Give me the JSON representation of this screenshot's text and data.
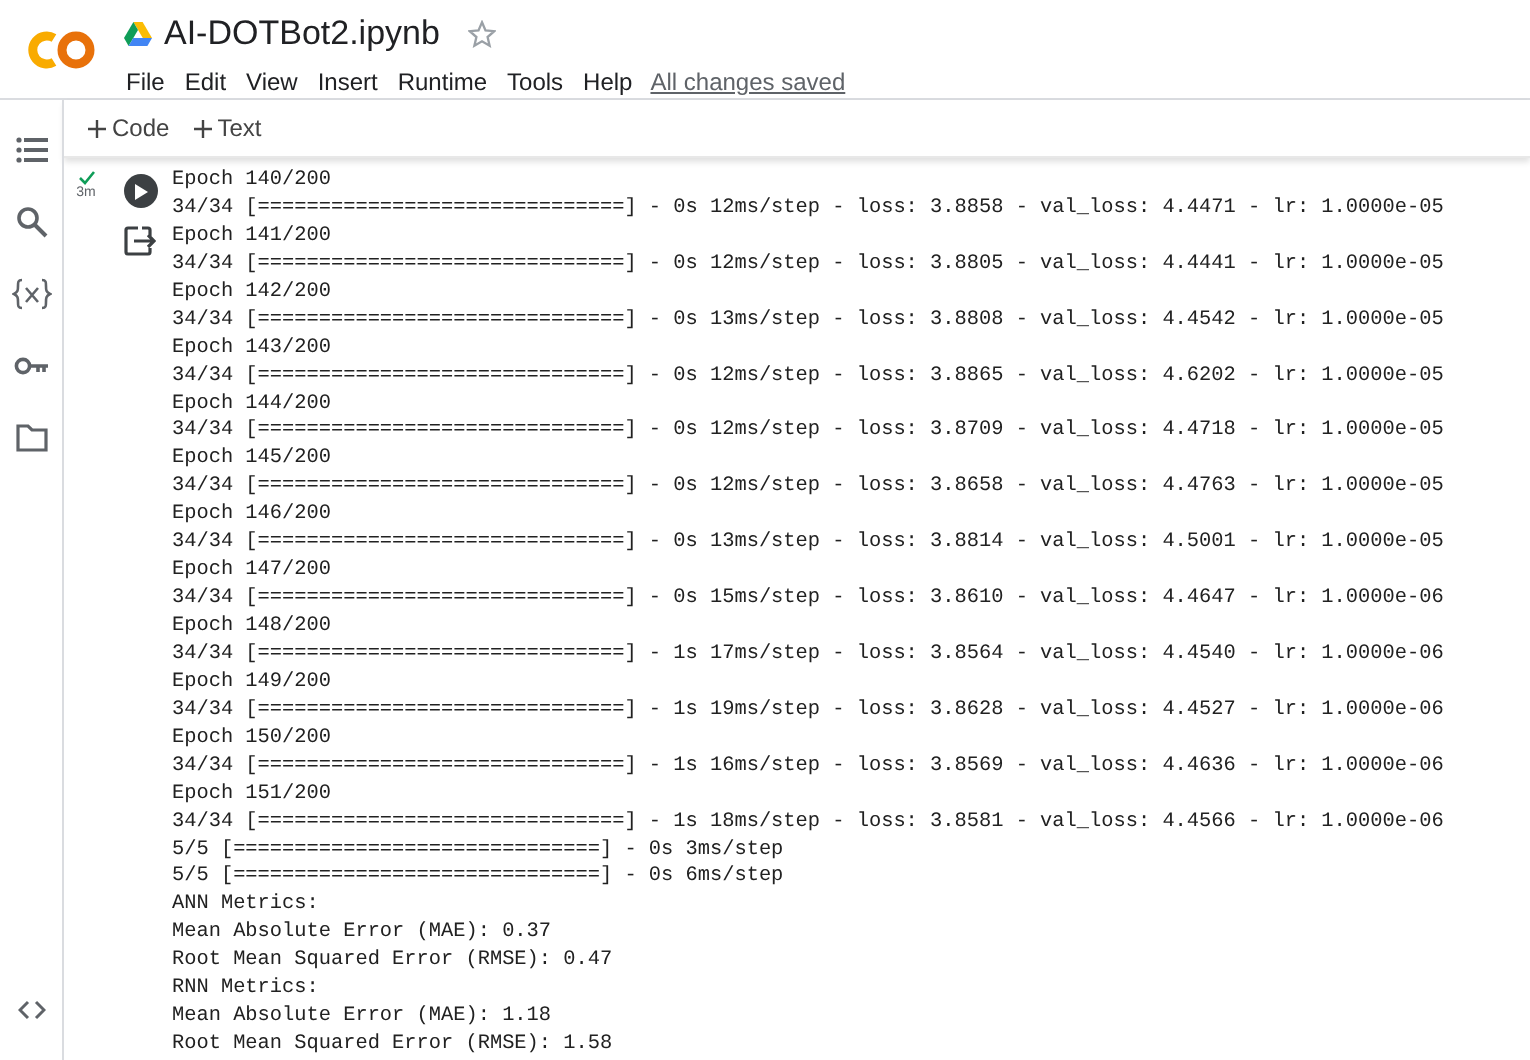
{
  "notebook": {
    "title": "AI-DOTBot2.ipynb",
    "starred": false
  },
  "menu": [
    "File",
    "Edit",
    "View",
    "Insert",
    "Runtime",
    "Tools",
    "Help"
  ],
  "save_status": "All changes saved",
  "toolbar": [
    "Code",
    "Text"
  ],
  "cell": {
    "completed": true,
    "elapsed": "3m",
    "output": [
      "Epoch 140/200",
      "34/34 [==============================] - 0s 12ms/step - loss: 3.8858 - val_loss: 4.4471 - lr: 1.0000e-05",
      "Epoch 141/200",
      "34/34 [==============================] - 0s 12ms/step - loss: 3.8805 - val_loss: 4.4441 - lr: 1.0000e-05",
      "Epoch 142/200",
      "34/34 [==============================] - 0s 13ms/step - loss: 3.8808 - val_loss: 4.4542 - lr: 1.0000e-05",
      "Epoch 143/200",
      "34/34 [==============================] - 0s 12ms/step - loss: 3.8865 - val_loss: 4.6202 - lr: 1.0000e-05",
      "Epoch 144/200",
      "34/34 [==============================] - 0s 12ms/step - loss: 3.8709 - val_loss: 4.4718 - lr: 1.0000e-05",
      "Epoch 145/200",
      "34/34 [==============================] - 0s 12ms/step - loss: 3.8658 - val_loss: 4.4763 - lr: 1.0000e-05",
      "Epoch 146/200",
      "34/34 [==============================] - 0s 13ms/step - loss: 3.8814 - val_loss: 4.5001 - lr: 1.0000e-05",
      "Epoch 147/200",
      "34/34 [==============================] - 0s 15ms/step - loss: 3.8610 - val_loss: 4.4647 - lr: 1.0000e-06",
      "Epoch 148/200",
      "34/34 [==============================] - 1s 17ms/step - loss: 3.8564 - val_loss: 4.4540 - lr: 1.0000e-06",
      "Epoch 149/200",
      "34/34 [==============================] - 1s 19ms/step - loss: 3.8628 - val_loss: 4.4527 - lr: 1.0000e-06",
      "Epoch 150/200",
      "34/34 [==============================] - 1s 16ms/step - loss: 3.8569 - val_loss: 4.4636 - lr: 1.0000e-06",
      "Epoch 151/200",
      "34/34 [==============================] - 1s 18ms/step - loss: 3.8581 - val_loss: 4.4566 - lr: 1.0000e-06",
      "5/5 [==============================] - 0s 3ms/step",
      "5/5 [==============================] - 0s 6ms/step",
      "ANN Metrics:",
      "Mean Absolute Error (MAE): 0.37",
      "Root Mean Squared Error (RMSE): 0.47",
      "RNN Metrics:",
      "Mean Absolute Error (MAE): 1.18",
      "Root Mean Squared Error (RMSE): 1.58"
    ]
  }
}
